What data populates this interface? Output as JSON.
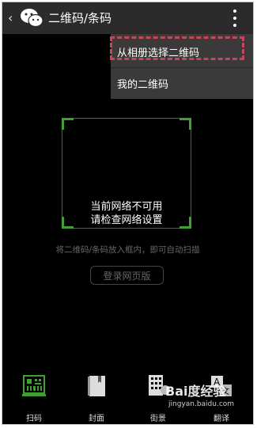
{
  "header": {
    "back_glyph": "‹",
    "title": "二维码/条码",
    "more_icon": "more-vert-icon"
  },
  "menu": {
    "items": [
      "从相册选择二维码",
      "我的二维码"
    ],
    "highlight_color": "#c8465a"
  },
  "scanner": {
    "status_line1": "当前网络不可用",
    "status_line2": "请检查网络设置",
    "hint": "将二维码/条码放入框内，即可自动扫描",
    "login_button": "登录网页版",
    "frame_color": "#3fa12f"
  },
  "tabs": [
    {
      "label": "扫码",
      "icon": "qr-scan-icon",
      "active": true,
      "color": "#3fa12f"
    },
    {
      "label": "封面",
      "icon": "book-icon",
      "active": false
    },
    {
      "label": "街景",
      "icon": "street-view-icon",
      "active": false
    },
    {
      "label": "翻译",
      "icon": "translate-icon",
      "active": false
    }
  ],
  "watermark": {
    "brand": "Bai度经验",
    "url": "jingyan.baidu.com"
  }
}
